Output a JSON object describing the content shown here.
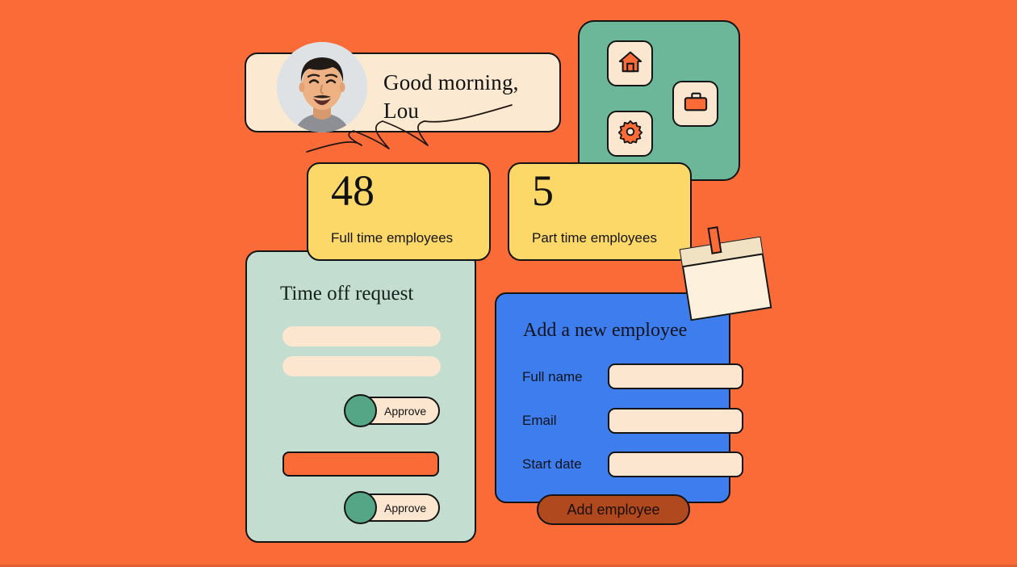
{
  "theme": {
    "background": "#fa6b38",
    "cream": "#fce9d2",
    "yellow": "#fcd868",
    "green_panel": "#6cb799",
    "sage_panel": "#c3ddd0",
    "blue_panel": "#3d7ded",
    "button_rust": "#b04a1e",
    "toggle_knob_green": "#55a587",
    "outline": "#141414"
  },
  "greeting": {
    "message": "Good morning, Lou",
    "avatar_alt": "avatar"
  },
  "icon_panel": {
    "tiles": [
      {
        "name": "home-icon",
        "label": "Home"
      },
      {
        "name": "gear-icon",
        "label": "Settings"
      },
      {
        "name": "briefcase-icon",
        "label": "Jobs"
      }
    ]
  },
  "stats": [
    {
      "value": "48",
      "label": "Full time employees"
    },
    {
      "value": "5",
      "label": "Part time employees"
    }
  ],
  "time_off": {
    "title": "Time off request",
    "rows": [
      {
        "toggle_label": "Approve",
        "state": "off"
      },
      {
        "toggle_label": "Approve",
        "state": "off"
      }
    ]
  },
  "add_employee": {
    "title": "Add a new employee",
    "fields": [
      {
        "label": "Full name",
        "value": "",
        "placeholder": ""
      },
      {
        "label": "Email",
        "value": "",
        "placeholder": ""
      },
      {
        "label": "Start date",
        "value": "",
        "placeholder": ""
      }
    ],
    "submit_label": "Add employee"
  }
}
